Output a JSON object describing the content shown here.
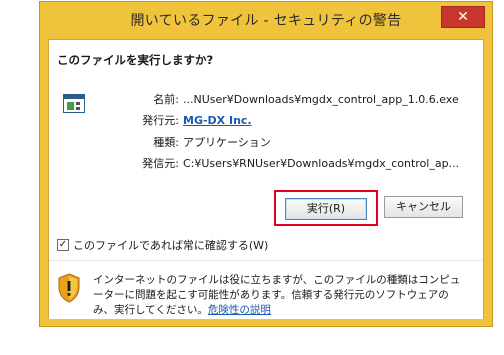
{
  "window": {
    "title": "開いているファイル - セキュリティの警告",
    "close_label": "✕"
  },
  "dialog": {
    "question": "このファイルを実行しますか?",
    "fields": [
      {
        "label": "名前:",
        "value": "...NUser¥Downloads¥mgdx_control_app_1.0.6.exe"
      },
      {
        "label": "発行元:",
        "value": "MG-DX Inc."
      },
      {
        "label": "種類:",
        "value": "アプリケーション"
      },
      {
        "label": "発信元:",
        "value": "C:¥Users¥RNUser¥Downloads¥mgdx_control_ap..."
      }
    ],
    "run_button": "実行(R)",
    "cancel_button": "キャンセル",
    "always_check_label": "このファイルであれば常に確認する(W)",
    "always_check_checked": true,
    "warning_text": "インターネットのファイルは役に立ちますが、このファイルの種類はコンピューターに問題を起こす可能性があります。信頼する発行元のソフトウェアのみ、実行してください。",
    "warning_link": "危険性の説明"
  },
  "colors": {
    "frame": "#f0c33c",
    "close": "#c7372c",
    "highlight": "#e0001b",
    "link": "#1a58b4"
  },
  "icons": {
    "app": "application-window-icon",
    "shield": "security-shield-icon"
  }
}
